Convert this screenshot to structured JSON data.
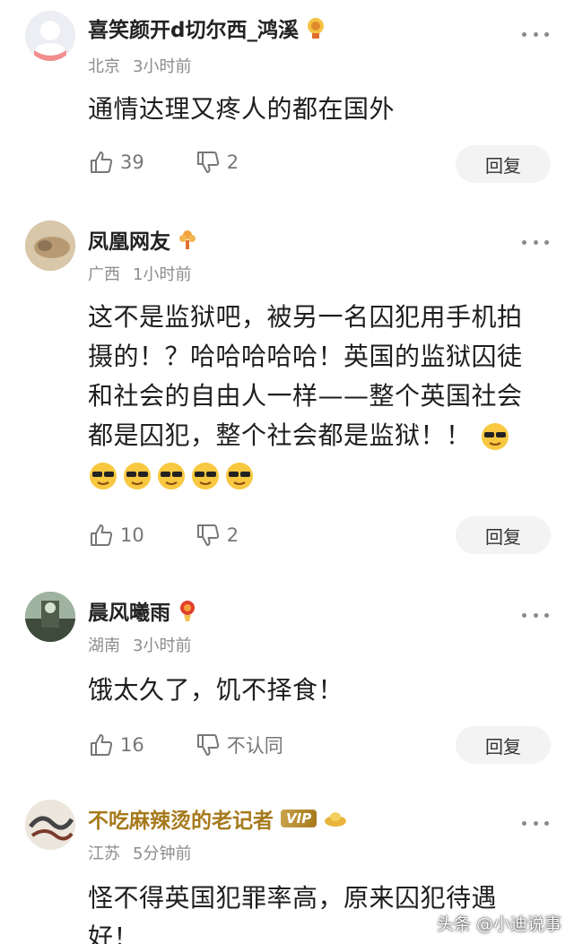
{
  "comments": [
    {
      "username": "喜笑颜开d切尔西_鸿溪",
      "location": "北京",
      "time": "3小时前",
      "text": "通情达理又疼人的都在国外",
      "likes": "39",
      "dislikes": "2",
      "reply_label": "回复"
    },
    {
      "username": "凤凰网友",
      "location": "广西",
      "time": "1小时前",
      "text": "这不是监狱吧，被另一名囚犯用手机拍摄的！？哈哈哈哈哈！英国的监狱囚徒和社会的自由人一样——整个英国社会都是囚犯，整个社会都是监狱！！",
      "emoji_count": 6,
      "likes": "10",
      "dislikes": "2",
      "reply_label": "回复"
    },
    {
      "username": "晨风曦雨",
      "location": "湖南",
      "time": "3小时前",
      "text": "饿太久了，饥不择食！",
      "likes": "16",
      "dislikes": "不认同",
      "reply_label": "回复"
    },
    {
      "username": "不吃麻辣烫的老记者",
      "vip_label": "VIP",
      "location": "江苏",
      "time": "5分钟前",
      "text": "怪不得英国犯罪率高，原来囚犯待遇好！"
    }
  ],
  "watermark": "头条 @小迪说事",
  "colors": {
    "vip_name": "#a67a1c",
    "meta_gray": "#8c8c8c",
    "reply_bg": "#f3f3f3"
  }
}
